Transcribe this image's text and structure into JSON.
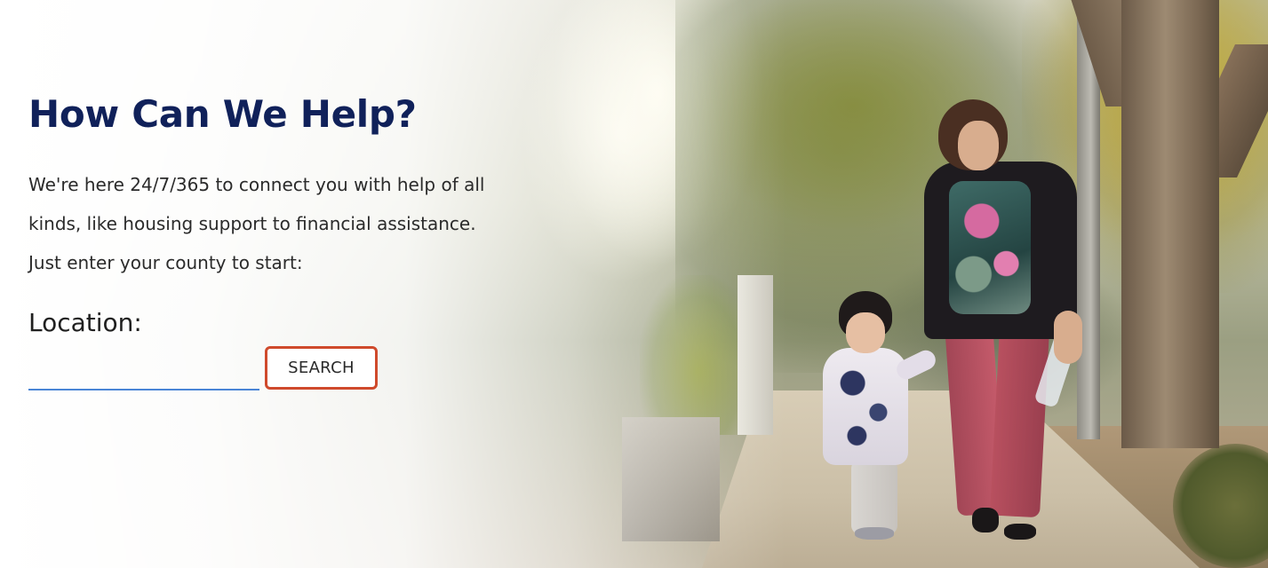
{
  "hero": {
    "title": "How Can We Help?",
    "description": "We're here 24/7/365 to connect you with help of all kinds, like housing support to financial assistance. Just enter your county to start:",
    "background_image": "woman-and-child-walking-photo"
  },
  "location": {
    "label": "Location:",
    "input_value": "",
    "input_placeholder": "",
    "search_label": "SEARCH"
  },
  "colors": {
    "title": "#10215a",
    "input_underline": "#4a85d6",
    "search_border": "#cf4a2c"
  }
}
